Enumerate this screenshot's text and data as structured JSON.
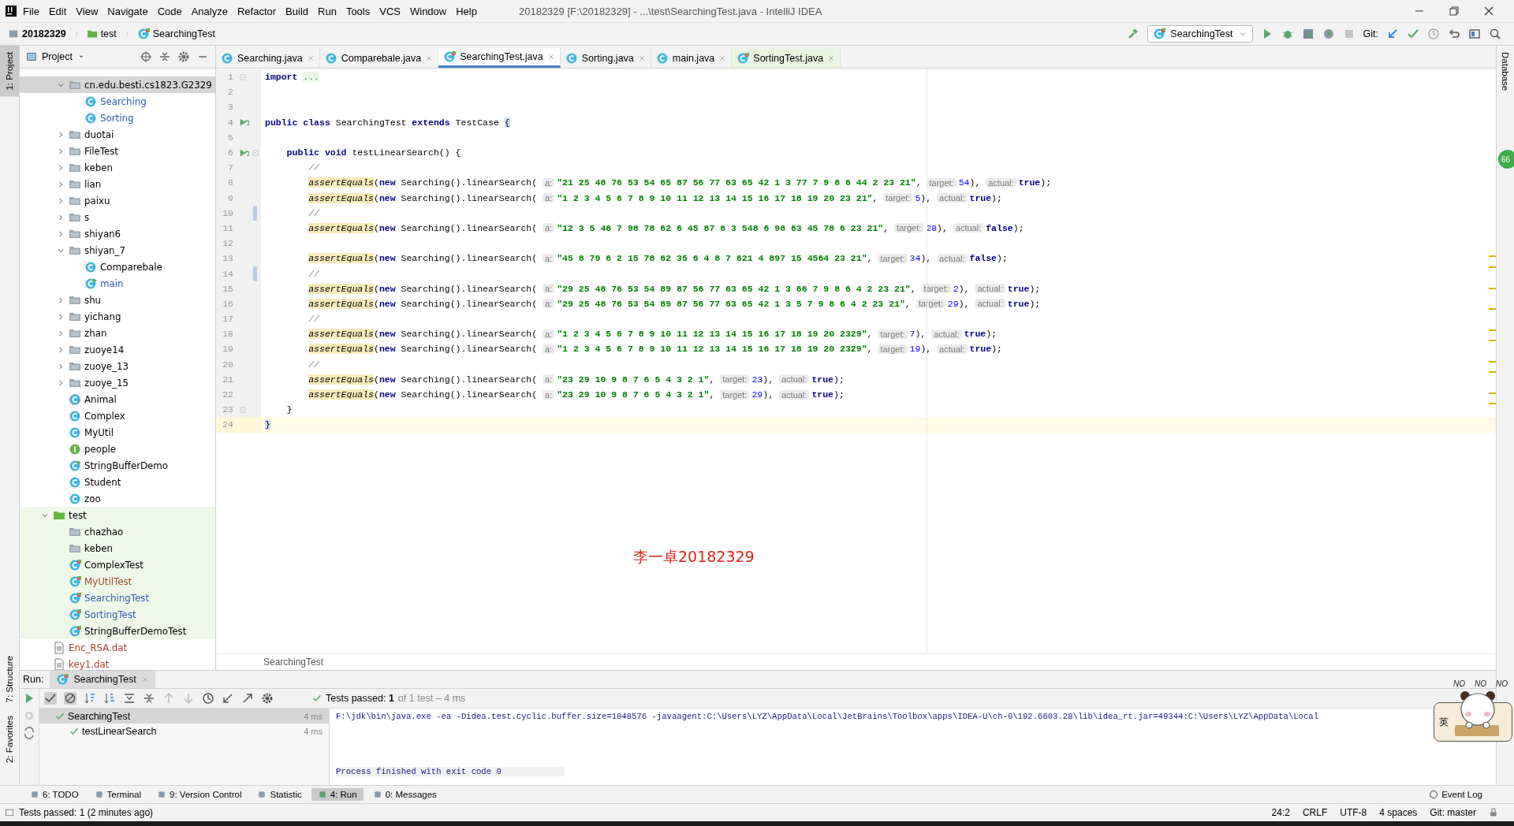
{
  "window": {
    "title": "20182329 [F:\\20182329] - ...\\test\\SearchingTest.java - IntelliJ IDEA"
  },
  "menu": [
    "File",
    "Edit",
    "View",
    "Navigate",
    "Code",
    "Analyze",
    "Refactor",
    "Build",
    "Run",
    "Tools",
    "VCS",
    "Window",
    "Help"
  ],
  "navbar": {
    "crumbs": [
      "20182329",
      "test",
      "SearchingTest"
    ],
    "run_config": "SearchingTest",
    "vcs_label": "Git:"
  },
  "left_strip": {
    "tabs": [
      {
        "label": "1: Project",
        "selected": true
      },
      {
        "label": "7: Structure",
        "selected": false
      },
      {
        "label": "2: Favorites",
        "selected": false
      }
    ]
  },
  "project": {
    "title": "Project",
    "clipped_folder_children": [
      {
        "label": "cn.edu.besti.cs1823.G2329",
        "kind": "package",
        "color": "#000000",
        "expanded": true,
        "selected": true,
        "children": [
          {
            "label": "Searching",
            "kind": "class",
            "color": "#2a5db0",
            "selected": false
          },
          {
            "label": "Sorting",
            "kind": "class",
            "color": "#2a5db0",
            "selected": false
          }
        ]
      },
      {
        "label": "duotai",
        "kind": "package",
        "color": "#000000",
        "expanded": false,
        "selected": false
      },
      {
        "label": "FileTest",
        "kind": "package",
        "color": "#000000",
        "expanded": false,
        "selected": false
      },
      {
        "label": "keben",
        "kind": "package",
        "color": "#000000",
        "expanded": false,
        "selected": false
      },
      {
        "label": "lian",
        "kind": "package",
        "color": "#000000",
        "expanded": false,
        "selected": false
      },
      {
        "label": "paixu",
        "kind": "package",
        "color": "#000000",
        "expanded": false,
        "selected": false
      },
      {
        "label": "s",
        "kind": "package",
        "color": "#000000",
        "expanded": false,
        "selected": false
      },
      {
        "label": "shiyan6",
        "kind": "package",
        "color": "#000000",
        "expanded": false,
        "selected": false
      },
      {
        "label": "shiyan_7",
        "kind": "package",
        "color": "#000000",
        "expanded": true,
        "selected": false,
        "children": [
          {
            "label": "Comparebale",
            "kind": "class",
            "color": "#000000",
            "selected": false
          },
          {
            "label": "main",
            "kind": "main-class",
            "color": "#2a5db0",
            "selected": false
          }
        ]
      },
      {
        "label": "shu",
        "kind": "package",
        "color": "#000000",
        "expanded": false,
        "selected": false
      },
      {
        "label": "yichang",
        "kind": "package",
        "color": "#000000",
        "expanded": false,
        "selected": false
      },
      {
        "label": "zhan",
        "kind": "package",
        "color": "#000000",
        "expanded": false,
        "selected": false
      },
      {
        "label": "zuoye14",
        "kind": "package",
        "color": "#000000",
        "expanded": false,
        "selected": false
      },
      {
        "label": "zuoye_13",
        "kind": "package",
        "color": "#000000",
        "expanded": false,
        "selected": false
      },
      {
        "label": "zuoye_15",
        "kind": "package",
        "color": "#000000",
        "expanded": false,
        "selected": false
      },
      {
        "label": "Animal",
        "kind": "abstract-class",
        "color": "#000000",
        "selected": false
      },
      {
        "label": "Complex",
        "kind": "class",
        "color": "#000000",
        "selected": false
      },
      {
        "label": "MyUtil",
        "kind": "class",
        "color": "#000000",
        "selected": false
      },
      {
        "label": "people",
        "kind": "interface",
        "color": "#000000",
        "selected": false
      },
      {
        "label": "StringBufferDemo",
        "kind": "main-class",
        "color": "#000000",
        "selected": false
      },
      {
        "label": "Student",
        "kind": "class",
        "color": "#000000",
        "selected": false
      },
      {
        "label": "zoo",
        "kind": "class",
        "color": "#000000",
        "selected": false
      }
    ],
    "items": [
      {
        "label": "test",
        "kind": "test-root",
        "color": "#000000",
        "expanded": true,
        "selected": false,
        "children": [
          {
            "label": "chazhao",
            "kind": "package",
            "color": "#000000",
            "selected": false
          },
          {
            "label": "keben",
            "kind": "package",
            "color": "#000000",
            "selected": false
          },
          {
            "label": "ComplexTest",
            "kind": "test-class",
            "color": "#000000",
            "selected": false
          },
          {
            "label": "MyUtilTest",
            "kind": "test-class",
            "color": "#a0452a",
            "selected": false
          },
          {
            "label": "SearchingTest",
            "kind": "test-class",
            "color": "#2a5db0",
            "selected": false
          },
          {
            "label": "SortingTest",
            "kind": "test-class",
            "color": "#2a5db0",
            "selected": false
          },
          {
            "label": "StringBufferDemoTest",
            "kind": "test-class",
            "color": "#000000",
            "selected": false
          }
        ]
      },
      {
        "label": "Enc_RSA.dat",
        "kind": "file",
        "color": "#a0452a",
        "selected": false
      },
      {
        "label": "key1.dat",
        "kind": "file",
        "color": "#a0452a",
        "selected": false
      }
    ]
  },
  "editor": {
    "tabs": [
      {
        "label": "Searching.java",
        "selected": false,
        "test": false
      },
      {
        "label": "Comparebale.java",
        "selected": false,
        "test": false
      },
      {
        "label": "SearchingTest.java",
        "selected": true,
        "test": true
      },
      {
        "label": "Sorting.java",
        "selected": false,
        "test": false
      },
      {
        "label": "main.java",
        "selected": false,
        "test": false
      },
      {
        "label": "SortingTest.java",
        "selected": false,
        "test": true
      }
    ],
    "lines": [
      {
        "number": "1",
        "current": false,
        "run_icon": false,
        "fold_marker": true,
        "changed": false,
        "tokens": [
          {
            "kind": "kw",
            "text": "import"
          },
          {
            "kind": "folded",
            "text": "..."
          }
        ]
      },
      {
        "number": "2",
        "current": false,
        "run_icon": false,
        "fold_marker": false,
        "changed": false
      },
      {
        "number": "3",
        "current": false,
        "run_icon": false,
        "fold_marker": false,
        "changed": false
      },
      {
        "number": "4",
        "current": false,
        "run_icon": true,
        "fold_marker": false,
        "changed": false,
        "tokens": [
          {
            "kind": "kw",
            "text": "public class"
          },
          {
            "kind": "plain",
            "text": " SearchingTest "
          },
          {
            "kind": "kw",
            "text": "extends"
          },
          {
            "kind": "plain",
            "text": " TestCase "
          },
          {
            "kind": "brace",
            "text": "{"
          }
        ],
        "children": [
          {
            "number": "5",
            "current": false,
            "run_icon": false,
            "fold_marker": false,
            "changed": false
          },
          {
            "number": "6",
            "current": false,
            "run_icon": true,
            "fold_marker": true,
            "changed": false,
            "tokens": [
              {
                "kind": "kw",
                "text": "public void"
              },
              {
                "kind": "plain",
                "text": " testLinearSearch() {"
              }
            ],
            "children": [
              {
                "number": "7",
                "current": false,
                "run_icon": false,
                "fold_marker": false,
                "changed": false,
                "tokens": [
                  {
                    "kind": "cmt",
                    "text": "//"
                  }
                ]
              },
              {
                "number": "8",
                "current": false,
                "run_icon": false,
                "fold_marker": false,
                "changed": false,
                "tokens": [
                  {
                    "kind": "call",
                    "text": "assertEquals"
                  },
                  {
                    "kind": "plain",
                    "text": "("
                  },
                  {
                    "kind": "kw",
                    "text": "new"
                  },
                  {
                    "kind": "plain",
                    "text": " Searching().linearSearch( "
                  },
                  {
                    "kind": "hint",
                    "text": "a:"
                  },
                  {
                    "kind": "str",
                    "text": "\"21 25 48 76 53 54 65 87 56 77 63 65 42 1 3 77 7 9 8 6 44 2 23 21\""
                  },
                  {
                    "kind": "plain",
                    "text": ", "
                  },
                  {
                    "kind": "hint",
                    "text": "target:"
                  },
                  {
                    "kind": "num",
                    "text": "54"
                  },
                  {
                    "kind": "plain",
                    "text": "), "
                  },
                  {
                    "kind": "hint",
                    "text": "actual:"
                  },
                  {
                    "kind": "kw",
                    "text": "true"
                  },
                  {
                    "kind": "plain",
                    "text": ");"
                  }
                ]
              },
              {
                "number": "9",
                "current": false,
                "run_icon": false,
                "fold_marker": false,
                "changed": false,
                "tokens": [
                  {
                    "kind": "call",
                    "text": "assertEquals"
                  },
                  {
                    "kind": "plain",
                    "text": "("
                  },
                  {
                    "kind": "kw",
                    "text": "new"
                  },
                  {
                    "kind": "plain",
                    "text": " Searching().linearSearch( "
                  },
                  {
                    "kind": "hint",
                    "text": "a:"
                  },
                  {
                    "kind": "str",
                    "text": "\"1 2 3 4 5 6 7 8 9 10 11 12 13 14 15 16 17 18 19 20 23 21\""
                  },
                  {
                    "kind": "plain",
                    "text": ", "
                  },
                  {
                    "kind": "hint",
                    "text": "target:"
                  },
                  {
                    "kind": "num",
                    "text": "5"
                  },
                  {
                    "kind": "plain",
                    "text": "), "
                  },
                  {
                    "kind": "hint",
                    "text": "actual:"
                  },
                  {
                    "kind": "kw",
                    "text": "true"
                  },
                  {
                    "kind": "plain",
                    "text": ");"
                  }
                ]
              },
              {
                "number": "10",
                "current": false,
                "run_icon": false,
                "fold_marker": false,
                "changed": true,
                "tokens": [
                  {
                    "kind": "cmt",
                    "text": "//"
                  }
                ]
              },
              {
                "number": "11",
                "current": false,
                "run_icon": false,
                "fold_marker": false,
                "changed": false,
                "tokens": [
                  {
                    "kind": "call",
                    "text": "assertEquals"
                  },
                  {
                    "kind": "plain",
                    "text": "("
                  },
                  {
                    "kind": "kw",
                    "text": "new"
                  },
                  {
                    "kind": "plain",
                    "text": " Searching().linearSearch( "
                  },
                  {
                    "kind": "hint",
                    "text": "a:"
                  },
                  {
                    "kind": "str",
                    "text": "\"12 3 5 48 7 98 78 62 6 45 87 6 3 548 6 98 63 45 78 6 23 21\""
                  },
                  {
                    "kind": "plain",
                    "text": ", "
                  },
                  {
                    "kind": "hint",
                    "text": "target:"
                  },
                  {
                    "kind": "num",
                    "text": "28"
                  },
                  {
                    "kind": "plain",
                    "text": "), "
                  },
                  {
                    "kind": "hint",
                    "text": "actual:"
                  },
                  {
                    "kind": "kw",
                    "text": "false"
                  },
                  {
                    "kind": "plain",
                    "text": ");"
                  }
                ]
              },
              {
                "number": "12",
                "current": false,
                "run_icon": false,
                "fold_marker": false,
                "changed": false
              },
              {
                "number": "13",
                "current": false,
                "run_icon": false,
                "fold_marker": false,
                "changed": false,
                "tokens": [
                  {
                    "kind": "call",
                    "text": "assertEquals"
                  },
                  {
                    "kind": "plain",
                    "text": "("
                  },
                  {
                    "kind": "kw",
                    "text": "new"
                  },
                  {
                    "kind": "plain",
                    "text": " Searching().linearSearch( "
                  },
                  {
                    "kind": "hint",
                    "text": "a:"
                  },
                  {
                    "kind": "str",
                    "text": "\"45 8 79 6 2 15 78 62 35 6 4 8 7 621 4 897 15 4564 23 21\""
                  },
                  {
                    "kind": "plain",
                    "text": ", "
                  },
                  {
                    "kind": "hint",
                    "text": "target:"
                  },
                  {
                    "kind": "num",
                    "text": "34"
                  },
                  {
                    "kind": "plain",
                    "text": "), "
                  },
                  {
                    "kind": "hint",
                    "text": "actual:"
                  },
                  {
                    "kind": "kw",
                    "text": "false"
                  },
                  {
                    "kind": "plain",
                    "text": ");"
                  }
                ]
              },
              {
                "number": "14",
                "current": false,
                "run_icon": false,
                "fold_marker": false,
                "changed": true,
                "tokens": [
                  {
                    "kind": "cmt",
                    "text": "//"
                  }
                ]
              },
              {
                "number": "15",
                "current": false,
                "run_icon": false,
                "fold_marker": false,
                "changed": false,
                "tokens": [
                  {
                    "kind": "call",
                    "text": "assertEquals"
                  },
                  {
                    "kind": "plain",
                    "text": "("
                  },
                  {
                    "kind": "kw",
                    "text": "new"
                  },
                  {
                    "kind": "plain",
                    "text": " Searching().linearSearch( "
                  },
                  {
                    "kind": "hint",
                    "text": "a:"
                  },
                  {
                    "kind": "str",
                    "text": "\"29 25 48 76 53 54 89 87 56 77 63 65 42 1 3 66 7 9 8 6 4 2 23 21\""
                  },
                  {
                    "kind": "plain",
                    "text": ", "
                  },
                  {
                    "kind": "hint",
                    "text": "target:"
                  },
                  {
                    "kind": "num",
                    "text": "2"
                  },
                  {
                    "kind": "plain",
                    "text": "), "
                  },
                  {
                    "kind": "hint",
                    "text": "actual:"
                  },
                  {
                    "kind": "kw",
                    "text": "true"
                  },
                  {
                    "kind": "plain",
                    "text": ");"
                  }
                ]
              },
              {
                "number": "16",
                "current": false,
                "run_icon": false,
                "fold_marker": false,
                "changed": false,
                "tokens": [
                  {
                    "kind": "call",
                    "text": "assertEquals"
                  },
                  {
                    "kind": "plain",
                    "text": "("
                  },
                  {
                    "kind": "kw",
                    "text": "new"
                  },
                  {
                    "kind": "plain",
                    "text": " Searching().linearSearch( "
                  },
                  {
                    "kind": "hint",
                    "text": "a:"
                  },
                  {
                    "kind": "str",
                    "text": "\"29 25 48 76 53 54 89 87 56 77 63 65 42 1 3 5 7 9 8 6 4 2 23 21\""
                  },
                  {
                    "kind": "plain",
                    "text": ", "
                  },
                  {
                    "kind": "hint",
                    "text": "target:"
                  },
                  {
                    "kind": "num",
                    "text": "29"
                  },
                  {
                    "kind": "plain",
                    "text": "), "
                  },
                  {
                    "kind": "hint",
                    "text": "actual:"
                  },
                  {
                    "kind": "kw",
                    "text": "true"
                  },
                  {
                    "kind": "plain",
                    "text": ");"
                  }
                ]
              },
              {
                "number": "17",
                "current": false,
                "run_icon": false,
                "fold_marker": false,
                "changed": false,
                "tokens": [
                  {
                    "kind": "cmt",
                    "text": "//"
                  }
                ]
              },
              {
                "number": "18",
                "current": false,
                "run_icon": false,
                "fold_marker": false,
                "changed": false,
                "tokens": [
                  {
                    "kind": "call",
                    "text": "assertEquals"
                  },
                  {
                    "kind": "plain",
                    "text": "("
                  },
                  {
                    "kind": "kw",
                    "text": "new"
                  },
                  {
                    "kind": "plain",
                    "text": " Searching().linearSearch( "
                  },
                  {
                    "kind": "hint",
                    "text": "a:"
                  },
                  {
                    "kind": "str",
                    "text": "\"1 2 3 4 5 6 7 8 9 10 11 12 13 14 15 16 17 18 19 20 2329\""
                  },
                  {
                    "kind": "plain",
                    "text": ", "
                  },
                  {
                    "kind": "hint",
                    "text": "target:"
                  },
                  {
                    "kind": "num",
                    "text": "7"
                  },
                  {
                    "kind": "plain",
                    "text": "), "
                  },
                  {
                    "kind": "hint",
                    "text": "actual:"
                  },
                  {
                    "kind": "kw",
                    "text": "true"
                  },
                  {
                    "kind": "plain",
                    "text": ");"
                  }
                ]
              },
              {
                "number": "19",
                "current": false,
                "run_icon": false,
                "fold_marker": false,
                "changed": false,
                "tokens": [
                  {
                    "kind": "call",
                    "text": "assertEquals"
                  },
                  {
                    "kind": "plain",
                    "text": "("
                  },
                  {
                    "kind": "kw",
                    "text": "new"
                  },
                  {
                    "kind": "plain",
                    "text": " Searching().linearSearch( "
                  },
                  {
                    "kind": "hint",
                    "text": "a:"
                  },
                  {
                    "kind": "str",
                    "text": "\"1 2 3 4 5 6 7 8 9 10 11 12 13 14 15 16 17 18 19 20 2329\""
                  },
                  {
                    "kind": "plain",
                    "text": ", "
                  },
                  {
                    "kind": "hint",
                    "text": "target:"
                  },
                  {
                    "kind": "num",
                    "text": "19"
                  },
                  {
                    "kind": "plain",
                    "text": "), "
                  },
                  {
                    "kind": "hint",
                    "text": "actual:"
                  },
                  {
                    "kind": "kw",
                    "text": "true"
                  },
                  {
                    "kind": "plain",
                    "text": ");"
                  }
                ]
              },
              {
                "number": "20",
                "current": false,
                "run_icon": false,
                "fold_marker": false,
                "changed": false,
                "tokens": [
                  {
                    "kind": "cmt",
                    "text": "//"
                  }
                ]
              },
              {
                "number": "21",
                "current": false,
                "run_icon": false,
                "fold_marker": false,
                "changed": false,
                "tokens": [
                  {
                    "kind": "call",
                    "text": "assertEquals"
                  },
                  {
                    "kind": "plain",
                    "text": "("
                  },
                  {
                    "kind": "kw",
                    "text": "new"
                  },
                  {
                    "kind": "plain",
                    "text": " Searching().linearSearch( "
                  },
                  {
                    "kind": "hint",
                    "text": "a:"
                  },
                  {
                    "kind": "str",
                    "text": "\"23 29 10 9 8 7 6 5 4 3 2 1\""
                  },
                  {
                    "kind": "plain",
                    "text": ", "
                  },
                  {
                    "kind": "hint",
                    "text": "target:"
                  },
                  {
                    "kind": "num",
                    "text": "23"
                  },
                  {
                    "kind": "plain",
                    "text": "), "
                  },
                  {
                    "kind": "hint",
                    "text": "actual:"
                  },
                  {
                    "kind": "kw",
                    "text": "true"
                  },
                  {
                    "kind": "plain",
                    "text": ");"
                  }
                ]
              },
              {
                "number": "22",
                "current": false,
                "run_icon": false,
                "fold_marker": false,
                "changed": false,
                "tokens": [
                  {
                    "kind": "call",
                    "text": "assertEquals"
                  },
                  {
                    "kind": "plain",
                    "text": "("
                  },
                  {
                    "kind": "kw",
                    "text": "new"
                  },
                  {
                    "kind": "plain",
                    "text": " Searching().linearSearch( "
                  },
                  {
                    "kind": "hint",
                    "text": "a:"
                  },
                  {
                    "kind": "str",
                    "text": "\"23 29 10 9 8 7 6 5 4 3 2 1\""
                  },
                  {
                    "kind": "plain",
                    "text": ", "
                  },
                  {
                    "kind": "hint",
                    "text": "target:"
                  },
                  {
                    "kind": "num",
                    "text": "29"
                  },
                  {
                    "kind": "plain",
                    "text": "), "
                  },
                  {
                    "kind": "hint",
                    "text": "actual:"
                  },
                  {
                    "kind": "kw",
                    "text": "true"
                  },
                  {
                    "kind": "plain",
                    "text": ");"
                  }
                ]
              }
            ]
          },
          {
            "number": "23",
            "current": false,
            "run_icon": false,
            "fold_marker": true,
            "changed": false,
            "tokens": [
              {
                "kind": "plain",
                "text": "}"
              }
            ]
          }
        ]
      },
      {
        "number": "24",
        "current": true,
        "run_icon": false,
        "fold_marker": false,
        "changed": false,
        "tokens": [
          {
            "kind": "brace",
            "text": "}"
          }
        ]
      }
    ],
    "breadcrumb": "SearchingTest",
    "overlay_text": "李一卓20182329",
    "badge": "66"
  },
  "right_strip": {
    "tabs": [
      "Database"
    ]
  },
  "run": {
    "label": "Run:",
    "tab": "SearchingTest",
    "status": "Tests passed: **1**",
    "status_detail": "of 1 test – 4 ms",
    "tests": [
      {
        "name": "SearchingTest",
        "time": "4 ms",
        "selected": true,
        "children": [
          {
            "name": "testLinearSearch",
            "time": "4 ms",
            "selected": false
          }
        ]
      }
    ],
    "console": [
      {
        "kind": "command",
        "text": "F:\\jdk\\bin\\java.exe -ea -Didea.test.cyclic.buffer.size=1048576 -javaagent:C:\\Users\\LYZ\\AppData\\Local\\JetBrains\\Toolbox\\apps\\IDEA-U\\ch-0\\192.6603.28\\lib\\idea_rt.jar=49344:C:\\Users\\LYZ\\AppData\\Local"
      },
      {
        "kind": "exit",
        "text": "Process finished with exit code 0"
      }
    ]
  },
  "ime": {
    "mode": "英",
    "stickers": [
      "NO",
      "NO",
      "NO"
    ]
  },
  "bottom_tabs": [
    {
      "label": "6: TODO",
      "selected": false
    },
    {
      "label": "Terminal",
      "selected": false
    },
    {
      "label": "9: Version Control",
      "selected": false
    },
    {
      "label": "Statistic",
      "selected": false
    },
    {
      "label": "4: Run",
      "selected": true
    },
    {
      "label": "0: Messages",
      "selected": false
    }
  ],
  "event_log": "Event Log",
  "status_bar": {
    "message": "Tests passed: 1 (2 minutes ago)",
    "items": [
      "24:2",
      "CRLF",
      "UTF-8",
      "4 spaces",
      "Git: master"
    ]
  }
}
